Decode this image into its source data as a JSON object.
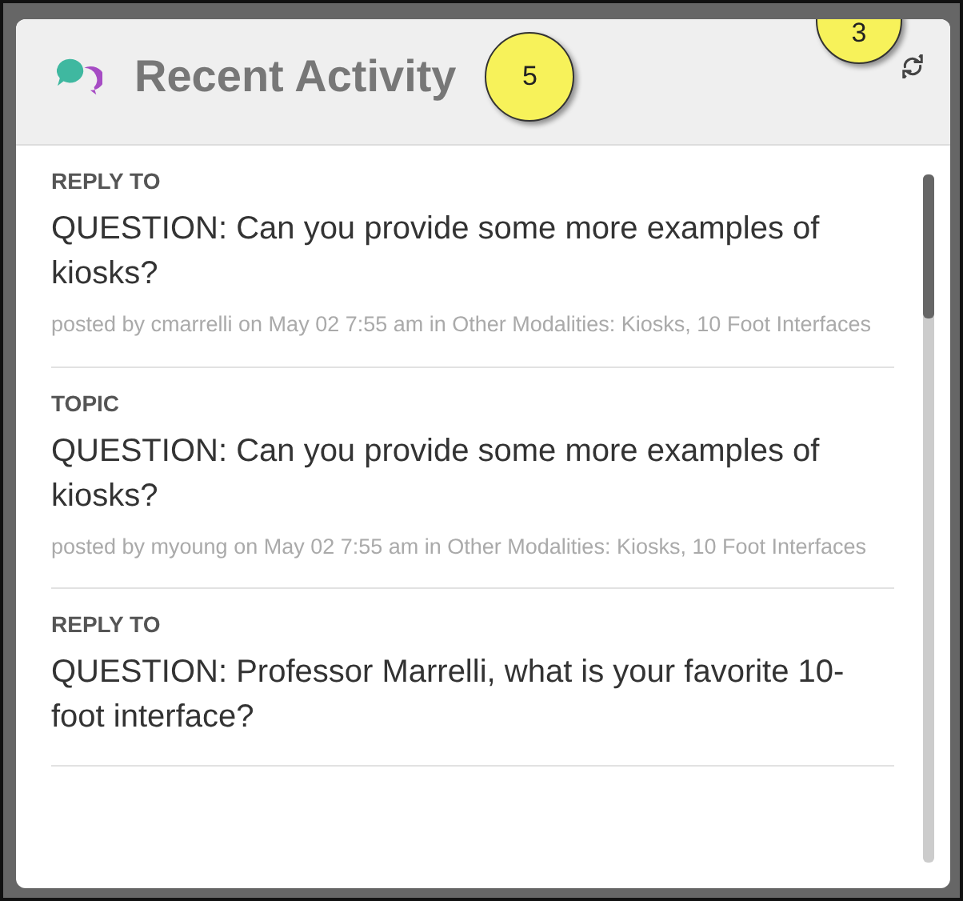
{
  "panel": {
    "title": "Recent Activity"
  },
  "callouts": [
    {
      "label": "5",
      "kind": "title"
    },
    {
      "label": "3",
      "kind": "corner"
    }
  ],
  "items": [
    {
      "type": "REPLY TO",
      "title": "QUESTION: Can you provide some more examples of kiosks?",
      "meta": "posted by cmarrelli on May 02 7:55 am in Other Modalities: Kiosks, 10 Foot Interfaces"
    },
    {
      "type": "TOPIC",
      "title": "QUESTION: Can you provide some more examples of kiosks?",
      "meta": "posted by myoung on May 02 7:55 am in Other Modalities: Kiosks, 10 Foot Interfaces"
    },
    {
      "type": "REPLY TO",
      "title": "QUESTION: Professor Marrelli, what is your favorite 10-foot interface?"
    }
  ]
}
